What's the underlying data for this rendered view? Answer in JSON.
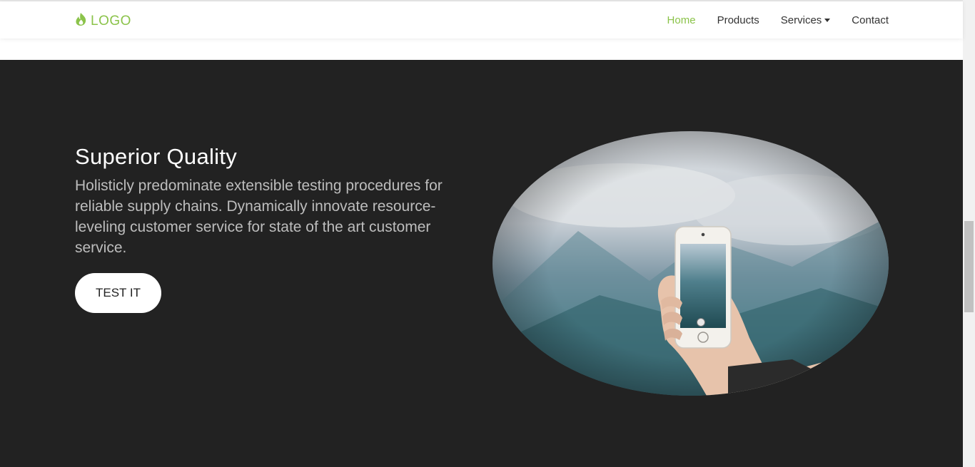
{
  "colors": {
    "accent": "#8bc34a",
    "hero_bg": "#222222",
    "nav_text": "#333333",
    "body_text": "#bdbdbd"
  },
  "logo": {
    "icon": "flame-icon",
    "text": "LOGO"
  },
  "nav": {
    "items": [
      {
        "label": "Home",
        "active": true
      },
      {
        "label": "Products"
      },
      {
        "label": "Services",
        "dropdown": true
      },
      {
        "label": "Contact"
      }
    ]
  },
  "hero": {
    "title": "Superior Quality",
    "text": "Holisticly predominate extensible testing procedures for reliable supply chains. Dynamically innovate resource-leveling customer service for state of the art customer service.",
    "button_label": "TEST IT",
    "image_icon": "hand-phone-photo-icon"
  }
}
